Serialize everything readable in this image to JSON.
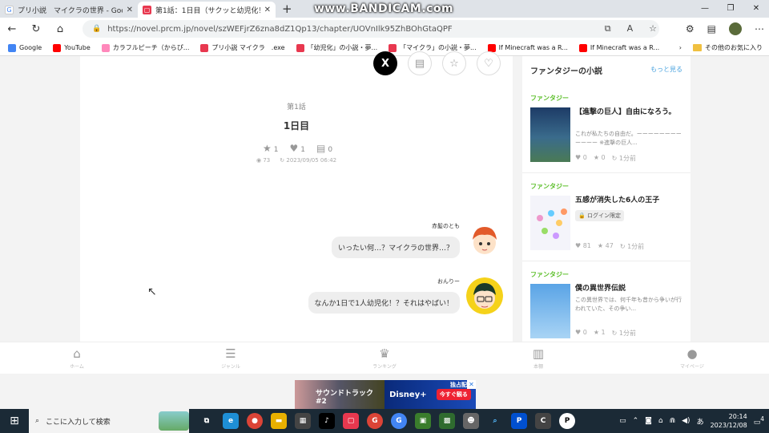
{
  "tabs": [
    {
      "label": "プリ小説　マイクラの世界 - Google",
      "favicon": "G",
      "active": false
    },
    {
      "label": "第1話：1日目（サクッと幼児化！-",
      "favicon": "P",
      "active": true
    }
  ],
  "overlay_watermark": "www.BANDICAM.com",
  "address_bar": {
    "url": "https://novel.prcm.jp/novel/szWEFjrZ6zna8dZ1Qp13/chapter/UOVnIlk95ZhBOhGtaQPF"
  },
  "bookmarks": [
    {
      "label": "Google",
      "icon": "google-icon"
    },
    {
      "label": "YouTube",
      "icon": "youtube-icon"
    },
    {
      "label": "カラフルピーチ（からぴ...",
      "icon": "peach-icon"
    },
    {
      "label": "プリ小説 マイクラ　.exe",
      "icon": "prcm-icon"
    },
    {
      "label": "「幼児化」の小説・夢...",
      "icon": "prcm-icon"
    },
    {
      "label": "「マイクラ」の小説・夢...",
      "icon": "prcm-icon"
    },
    {
      "label": "If Minecraft was a R...",
      "icon": "youtube-icon"
    },
    {
      "label": "If Minecraft was a R...",
      "icon": "youtube-icon"
    }
  ],
  "bookmarks_other": "その他のお気に入り",
  "chapter": {
    "label": "第1話",
    "title": "1日目",
    "stars": "1",
    "hearts": "1",
    "comments": "0",
    "views": "73",
    "date": "2023/09/05 06:42"
  },
  "messages": [
    {
      "name": "赤髪のとも",
      "text": "いったい何…？マイクラの世界…？"
    },
    {
      "name": "おんりー",
      "text": "なんか1日で1人幼児化！？それはやばい！"
    }
  ],
  "sidebar": {
    "heading": "ファンタジーの小説",
    "more": "もっと見る",
    "cards": [
      {
        "category": "ファンタジー",
        "title": "【進撃の巨人】自由になろう。",
        "desc": "これが私たちの自由だ。ーーーーーーーーーーーー ※進撃の巨人...",
        "hearts": "0",
        "stars": "0",
        "updated": "1分前"
      },
      {
        "category": "ファンタジー",
        "title": "五感が消失した6人の王子",
        "badge": "ログイン限定",
        "hearts": "81",
        "stars": "47",
        "updated": "1分前"
      },
      {
        "category": "ファンタジー",
        "title": "僕の異世界伝説",
        "desc": "この異世界では、何千年も昔から争いが行われていた、その争い...",
        "hearts": "0",
        "stars": "1",
        "updated": "1分前"
      }
    ]
  },
  "bottom_nav": [
    {
      "label": "ホーム",
      "icon": "home-icon"
    },
    {
      "label": "ジャンル",
      "icon": "list-icon"
    },
    {
      "label": "ランキング",
      "icon": "crown-icon"
    },
    {
      "label": "本棚",
      "icon": "bookshelf-icon"
    },
    {
      "label": "マイページ",
      "icon": "user-icon"
    }
  ],
  "ad": {
    "left_text": "サウンドトラック #2",
    "brand": "Disney+",
    "badge": "独占配信",
    "cta": "今すぐ観る"
  },
  "taskbar": {
    "search_placeholder": "ここに入力して検索",
    "time": "20:14",
    "date": "2023/12/08",
    "notifications": "4"
  }
}
